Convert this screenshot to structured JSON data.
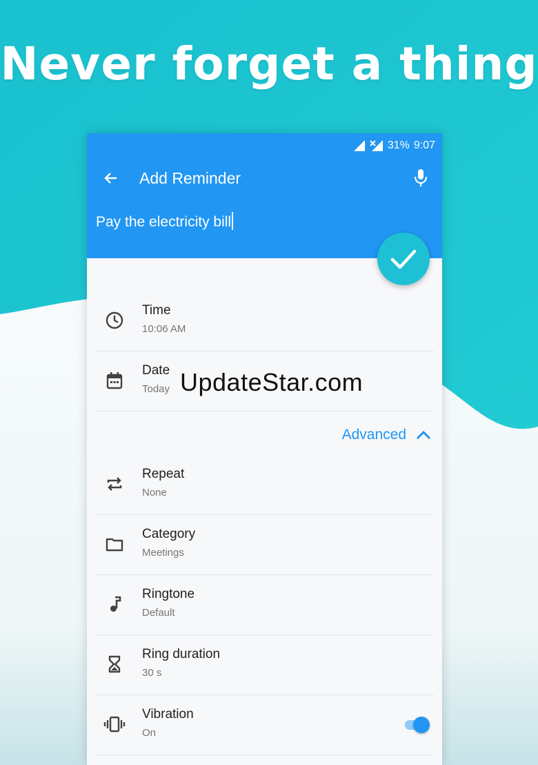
{
  "headline": "Never forget a thing",
  "status_bar": {
    "battery": "31%",
    "time": "9:07"
  },
  "toolbar": {
    "title": "Add Reminder"
  },
  "reminder_text": "Pay the electricity bill",
  "rows": [
    {
      "label": "Time",
      "value": "10:06 AM",
      "icon": "clock-icon"
    },
    {
      "label": "Date",
      "value": "Today",
      "icon": "calendar-icon"
    },
    {
      "label": "Repeat",
      "value": "None",
      "icon": "repeat-icon"
    },
    {
      "label": "Category",
      "value": "Meetings",
      "icon": "folder-icon"
    },
    {
      "label": "Ringtone",
      "value": "Default",
      "icon": "music-note-icon"
    },
    {
      "label": "Ring duration",
      "value": "30 s",
      "icon": "hourglass-icon"
    },
    {
      "label": "Vibration",
      "value": "On",
      "icon": "vibration-icon"
    }
  ],
  "advanced_label": "Advanced",
  "vibration_toggle_on": true,
  "watermark": "UpdateStar.com",
  "colors": {
    "app_bar": "#2196f3",
    "fab": "#1ec0d4",
    "background_teal": "#1cc2cf",
    "accent": "#2196f3"
  }
}
